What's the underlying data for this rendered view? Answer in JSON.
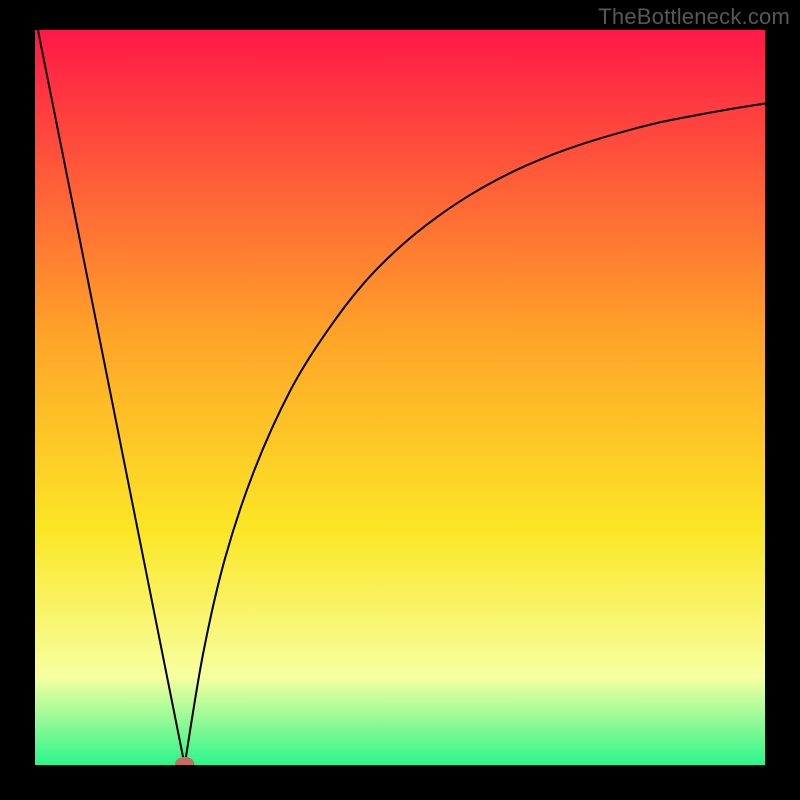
{
  "watermark": "TheBottleneck.com",
  "chart_data": {
    "type": "line",
    "title": "",
    "xlabel": "",
    "ylabel": "",
    "xlim": [
      0,
      100
    ],
    "ylim": [
      0,
      100
    ],
    "gradient_colors": {
      "top": "#ff1848",
      "upper_mid": "#ffa528",
      "mid": "#fbe625",
      "lower_mid": "#f7ffa0",
      "bottom": "#2bf58c"
    },
    "curves": [
      {
        "name": "left-branch",
        "x": [
          0,
          20.5
        ],
        "y": [
          102,
          0
        ]
      },
      {
        "name": "right-branch",
        "x": [
          20.5,
          23,
          26,
          30,
          35,
          40,
          45,
          50,
          55,
          60,
          65,
          70,
          75,
          80,
          85,
          90,
          95,
          100
        ],
        "y": [
          0,
          15,
          28,
          40,
          51,
          59,
          65.5,
          70.5,
          74.5,
          77.8,
          80.5,
          82.7,
          84.5,
          86,
          87.3,
          88.3,
          89.2,
          90
        ]
      }
    ],
    "marker": {
      "x": 20.5,
      "y": 0.2,
      "color": "#c76b62",
      "rx": 1.3,
      "ry": 0.9
    }
  }
}
